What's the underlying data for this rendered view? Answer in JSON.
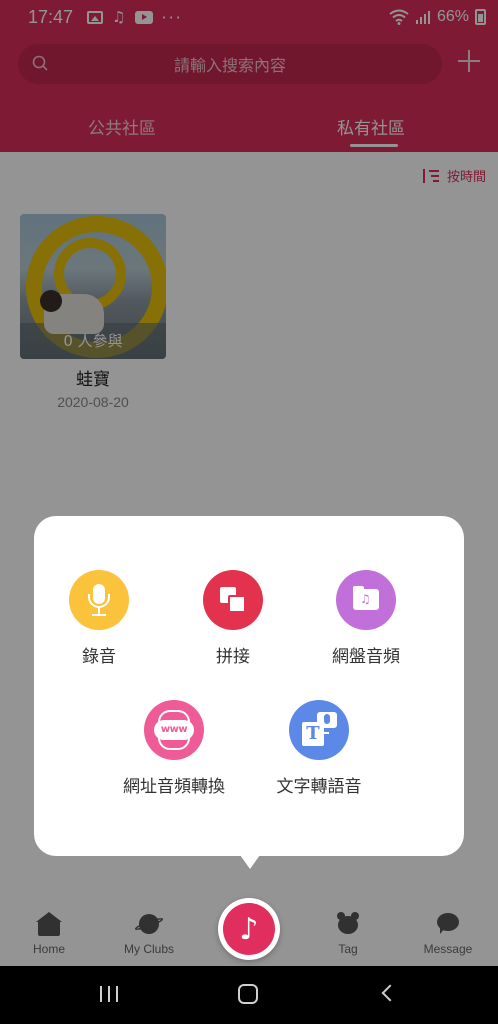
{
  "status_bar": {
    "time": "17:47",
    "dots": "···",
    "battery": "66%"
  },
  "search": {
    "placeholder": "請輸入搜索內容"
  },
  "tabs": [
    {
      "label": "公共社區",
      "active": false
    },
    {
      "label": "私有社區",
      "active": true
    }
  ],
  "sort": {
    "label": "按時間"
  },
  "clubs": [
    {
      "name": "蛙寶",
      "date": "2020-08-20",
      "participants": "0 人參與"
    }
  ],
  "popup": {
    "actions": [
      {
        "label": "錄音",
        "icon": "microphone-icon",
        "color": "#fbc23b"
      },
      {
        "label": "拼接",
        "icon": "splice-icon",
        "color": "#e3324e"
      },
      {
        "label": "網盤音頻",
        "icon": "cloud-folder-icon",
        "color": "#c16fd9"
      },
      {
        "label": "網址音頻轉換",
        "icon": "www-icon",
        "color": "#ef5b97"
      },
      {
        "label": "文字轉語音",
        "icon": "text-to-speech-icon",
        "color": "#5c88e8"
      }
    ],
    "www_text": "www",
    "tts_letter": "T"
  },
  "bottom_nav": [
    {
      "label": "Home",
      "icon": "home-icon"
    },
    {
      "label": "My Clubs",
      "icon": "planet-icon"
    },
    {
      "label": "Tag",
      "icon": "bear-icon"
    },
    {
      "label": "Message",
      "icon": "message-icon"
    }
  ],
  "colors": {
    "primary": "#d92d5b",
    "center_button": "#e02e5f"
  }
}
